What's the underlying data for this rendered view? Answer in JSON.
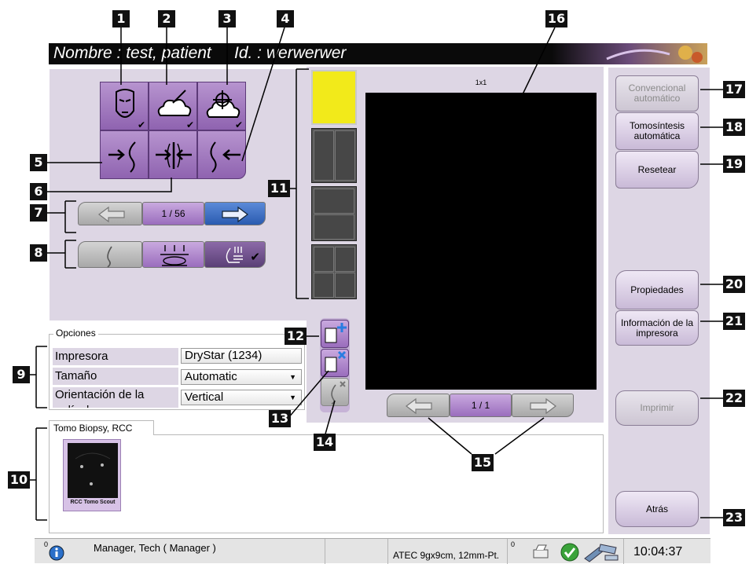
{
  "patient_bar": {
    "name_label": "Nombre : test, patient",
    "id_label": "Id. : werwerwer"
  },
  "callouts": [
    "1",
    "2",
    "3",
    "4",
    "5",
    "6",
    "7",
    "8",
    "9",
    "10",
    "11",
    "12",
    "13",
    "14",
    "15",
    "16",
    "17",
    "18",
    "19",
    "20",
    "21",
    "22",
    "23"
  ],
  "navigation": {
    "image_counter": "1 / 56",
    "page_counter": "1 / 1"
  },
  "layout_viewer": {
    "layout_label": "1x1"
  },
  "options": {
    "legend": "Opciones",
    "rows": [
      {
        "label": "Impresora",
        "value": "DryStar (1234)"
      },
      {
        "label": "Tamaño",
        "value": "Automatic"
      },
      {
        "label": "Orientación de la película",
        "value": "Vertical"
      }
    ]
  },
  "thumbnails": {
    "tab_label": "Tomo Biopsy, RCC",
    "items": [
      {
        "caption": "RCC Tomo Scout"
      }
    ]
  },
  "right_panel": {
    "auto_conventional": "Convencional automático",
    "auto_tomo": "Tomosíntesis automática",
    "reset": "Resetear",
    "properties": "Propiedades",
    "printer_info": "Información de la impresora",
    "print": "Imprimir",
    "back": "Atrás"
  },
  "status_bar": {
    "alarm_count": "0",
    "user": "Manager, Tech ( Manager )",
    "paddle": "ATEC 9gx9cm, 12mm-Pt.",
    "queue_count": "0",
    "time": "10:04:37"
  },
  "colors": {
    "panel": "#ddd6e4",
    "button_purple": "#9a6dbd",
    "selected_layout": "#f2ea1a",
    "nav_blue": "#2a5bb0"
  }
}
